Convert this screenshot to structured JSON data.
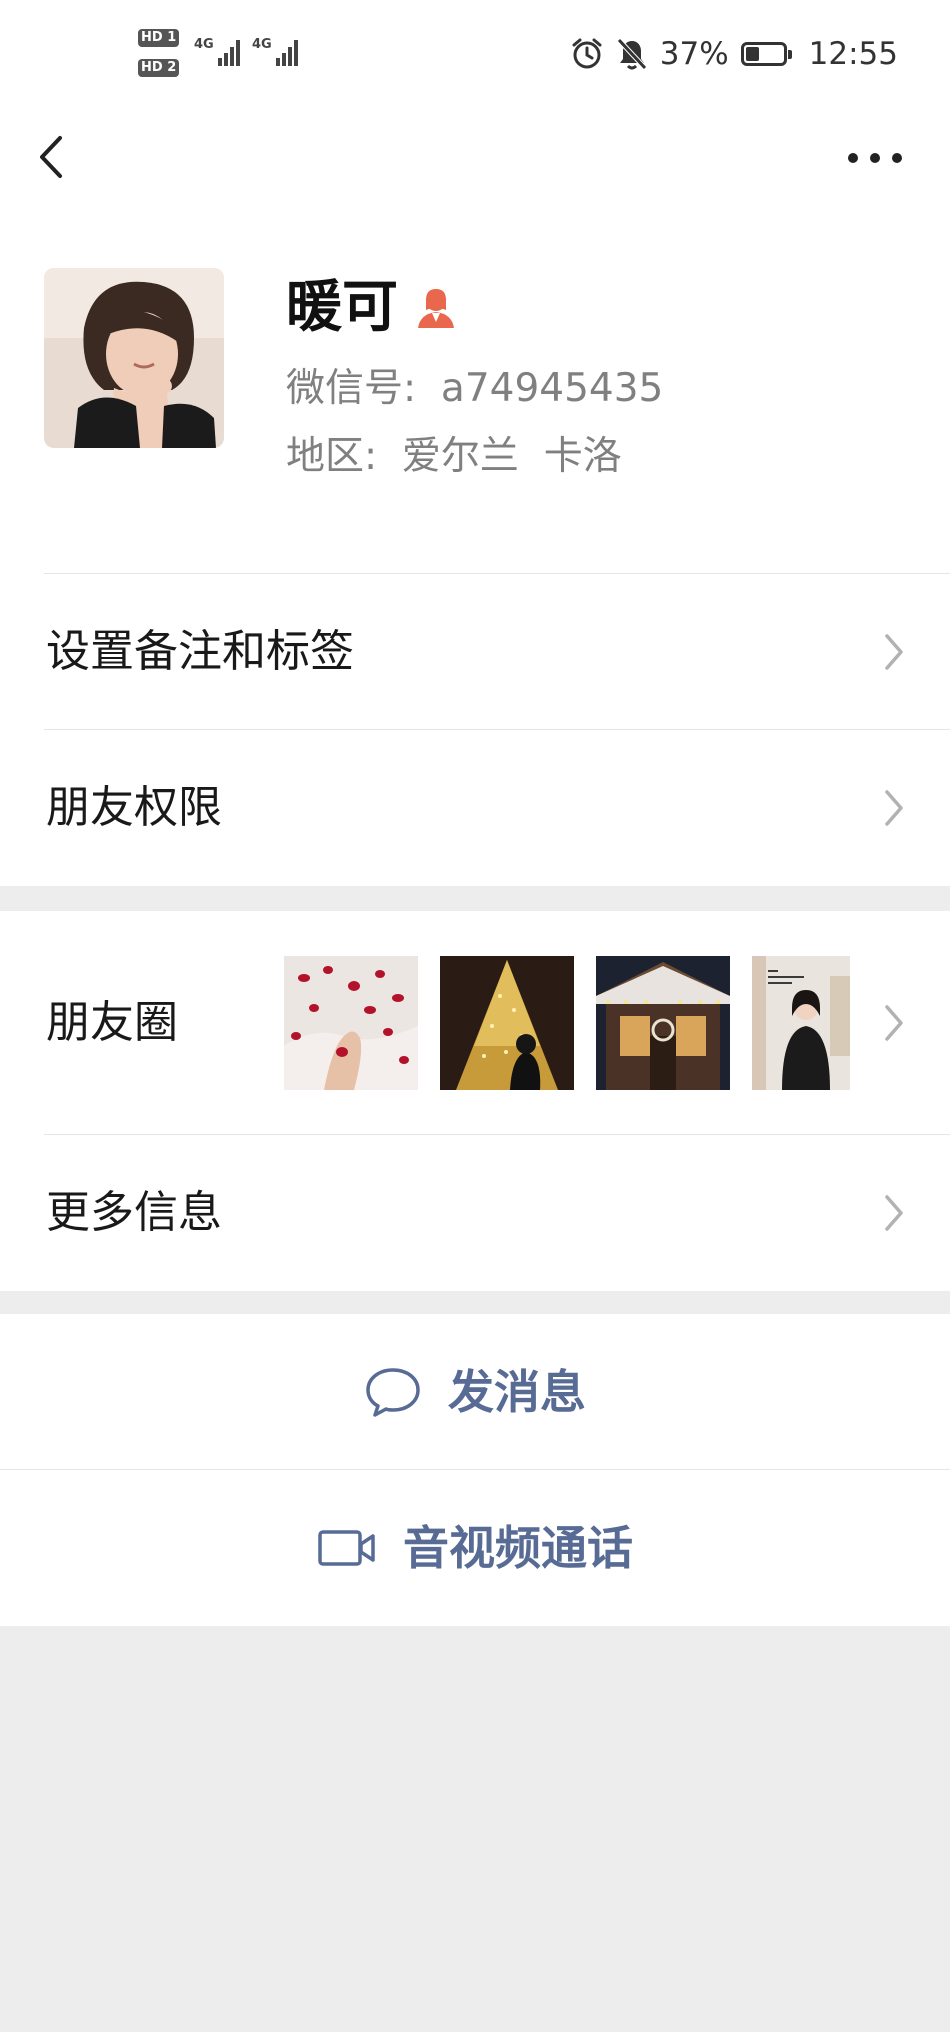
{
  "status_bar": {
    "sim1": "HD 1",
    "sim2": "HD 2",
    "net1": "4G",
    "net2": "4G",
    "battery": "37%",
    "battery_level": 0.37,
    "time": "12:55",
    "icons": [
      "alarm-icon",
      "mute-icon",
      "battery-icon"
    ]
  },
  "navbar": {
    "back_icon": "chevron-left-icon",
    "more_icon": "more-dots-icon"
  },
  "profile": {
    "name": "暖可",
    "gender_icon": "female-icon",
    "wechat_id": "微信号:  a74945435",
    "region": "地区:  爱尔兰  卡洛"
  },
  "menu": {
    "remark_tags": "设置备注和标签",
    "permissions": "朋友权限",
    "moments": "朋友圈",
    "more_info": "更多信息"
  },
  "actions": {
    "message": "发消息",
    "call": "音视频通话"
  },
  "colors": {
    "link_blue": "#576b95",
    "background": "#ededed",
    "gender_orange": "#e9674d"
  }
}
